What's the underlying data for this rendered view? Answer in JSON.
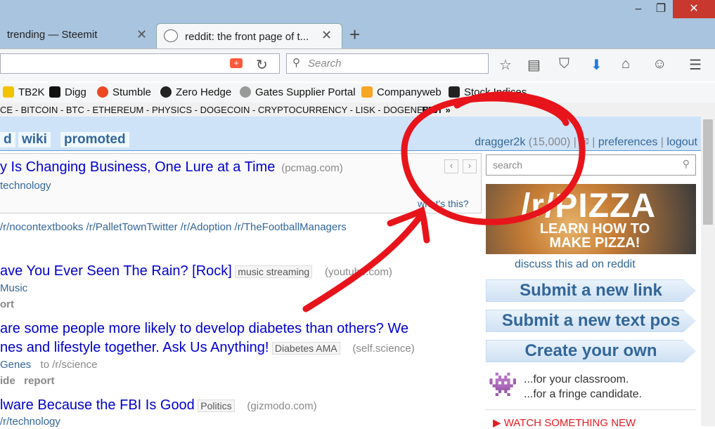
{
  "browser": {
    "tabs": [
      {
        "label": "trending — Steemit"
      },
      {
        "label": "reddit: the front page of t..."
      }
    ],
    "window_controls": [
      "–",
      "❐",
      "✕"
    ],
    "search_placeholder": "Search",
    "bookmarks": [
      "TB2K",
      "Digg",
      "Stumble",
      "Zero Hedge",
      "Gates Supplier Portal",
      "Companyweb",
      "Stock Indices"
    ]
  },
  "reddit": {
    "subreddit_bar": "CE - BITCOIN - BTC - ETHEREUM - PHYSICS - DOGECOIN - CRYPTOCURRENCY - LISK - DOGENEWS",
    "subreddit_edit": "EDIT »",
    "header_tabs": [
      "d",
      "wiki",
      "promoted"
    ],
    "user": {
      "name": "dragger2k",
      "karma": "(15,000)",
      "preferences": "preferences",
      "logout": "logout"
    },
    "sponsored": {
      "title": "y Is Changing Business, One Lure at a Time",
      "domain": "(pcmag.com)",
      "subreddit": "technology",
      "whats_this": "what's this?"
    },
    "sidebar": {
      "search_placeholder": "search",
      "ad_title": "/r/PIZZA",
      "ad_subtitle": "LEARN HOW TO MAKE PIZZA!",
      "ad_discuss": "discuss this ad on reddit",
      "submit_link": "Submit a new link",
      "submit_text": "Submit a new text pos",
      "create": "Create your own",
      "create_line1": "...for your classroom.",
      "create_line2": "...for a fringe candidate.",
      "watch": "▶ WATCH SOMETHING NEW"
    },
    "trending": "/r/nocontextbooks /r/PalletTownTwitter /r/Adoption /r/TheFootballManagers",
    "posts": [
      {
        "title": "ave You Ever Seen The Rain? [Rock]",
        "flair": "music streaming",
        "domain": "(youtube.com)",
        "sub": "Music",
        "action": "ort"
      },
      {
        "title_line1": "are some people more likely to develop diabetes than others? We",
        "title_line2": "nes and lifestyle together. Ask Us Anything!",
        "flair": "Diabetes AMA",
        "domain": "(self.science)",
        "sub": "Genes",
        "to": "to /r/science",
        "action": "ide   report"
      },
      {
        "title": "lware Because the FBI Is Good",
        "flair": "Politics",
        "domain": "(gizmodo.com)",
        "sub": "/r/technology"
      }
    ]
  },
  "colors": {
    "annotation": "#e8141b",
    "link": "#0000cc",
    "header": "#cee3f8"
  }
}
